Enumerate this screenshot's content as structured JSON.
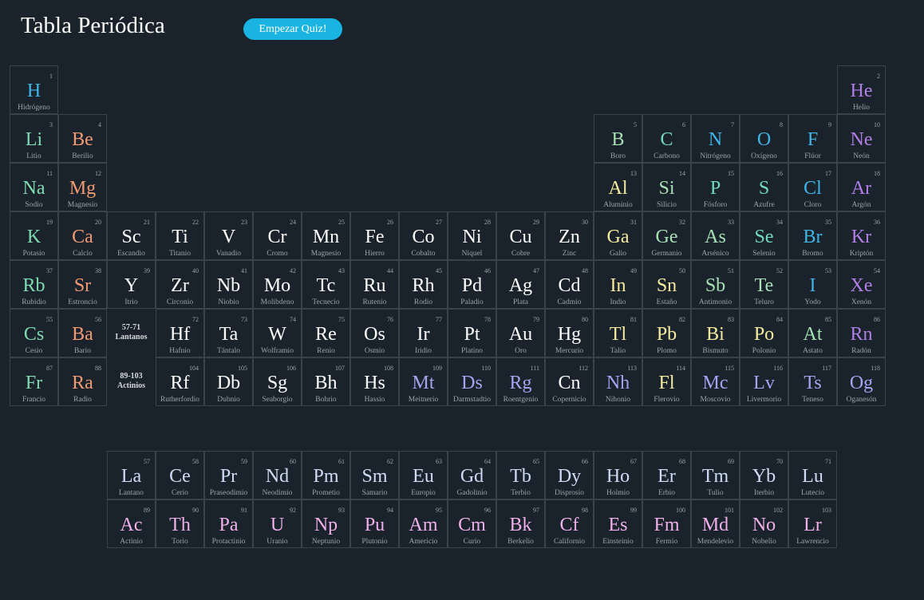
{
  "app": {
    "title": "Tabla Periódica",
    "quiz_button": "Empezar Quiz!"
  },
  "colors": {
    "background": "#1a232b",
    "cell_border": "#38434c",
    "button": "#1ab4e2",
    "categories": {
      "hidrogeno": "#3fb6e6",
      "alcalino": "#7fdbb1",
      "alcalinoterreo": "#f39a72",
      "transicion": "#ffffff",
      "postransicion": "#f6eca0",
      "metaloide": "#a8e0b5",
      "nometal": "#72d9c3",
      "halogeno": "#3fb6e6",
      "noble": "#b07fe8",
      "desconocido": "#a7a3f0",
      "lantanido": "#d0dcf6",
      "actinido": "#f0b0ea"
    }
  },
  "placeholders": [
    {
      "id": "lantanos",
      "range": "57-71",
      "label": "Lantanos"
    },
    {
      "id": "actinios",
      "range": "89-103",
      "label": "Actinios"
    }
  ],
  "elements": [
    {
      "n": 1,
      "s": "H",
      "name": "Hidrógeno",
      "c": "hidrogeno"
    },
    {
      "n": 2,
      "s": "He",
      "name": "Helio",
      "c": "noble"
    },
    {
      "n": 3,
      "s": "Li",
      "name": "Litio",
      "c": "alcalino"
    },
    {
      "n": 4,
      "s": "Be",
      "name": "Berilio",
      "c": "alcalinoterreo"
    },
    {
      "n": 5,
      "s": "B",
      "name": "Boro",
      "c": "metaloide"
    },
    {
      "n": 6,
      "s": "C",
      "name": "Carbono",
      "c": "nometal"
    },
    {
      "n": 7,
      "s": "N",
      "name": "Nitrógeno",
      "c": "halogeno"
    },
    {
      "n": 8,
      "s": "O",
      "name": "Oxígeno",
      "c": "halogeno"
    },
    {
      "n": 9,
      "s": "F",
      "name": "Flúor",
      "c": "halogeno"
    },
    {
      "n": 10,
      "s": "Ne",
      "name": "Neón",
      "c": "noble"
    },
    {
      "n": 11,
      "s": "Na",
      "name": "Sodio",
      "c": "alcalino"
    },
    {
      "n": 12,
      "s": "Mg",
      "name": "Magnesio",
      "c": "alcalinoterreo"
    },
    {
      "n": 13,
      "s": "Al",
      "name": "Aluminio",
      "c": "postransicion"
    },
    {
      "n": 14,
      "s": "Si",
      "name": "Silicio",
      "c": "metaloide"
    },
    {
      "n": 15,
      "s": "P",
      "name": "Fósforo",
      "c": "nometal"
    },
    {
      "n": 16,
      "s": "S",
      "name": "Azufre",
      "c": "nometal"
    },
    {
      "n": 17,
      "s": "Cl",
      "name": "Cloro",
      "c": "halogeno"
    },
    {
      "n": 18,
      "s": "Ar",
      "name": "Argón",
      "c": "noble"
    },
    {
      "n": 19,
      "s": "K",
      "name": "Potasio",
      "c": "alcalino"
    },
    {
      "n": 20,
      "s": "Ca",
      "name": "Calcio",
      "c": "alcalinoterreo"
    },
    {
      "n": 21,
      "s": "Sc",
      "name": "Escandio",
      "c": "transicion"
    },
    {
      "n": 22,
      "s": "Ti",
      "name": "Titanio",
      "c": "transicion"
    },
    {
      "n": 23,
      "s": "V",
      "name": "Vanadio",
      "c": "transicion"
    },
    {
      "n": 24,
      "s": "Cr",
      "name": "Cromo",
      "c": "transicion"
    },
    {
      "n": 25,
      "s": "Mn",
      "name": "Magnesio",
      "c": "transicion"
    },
    {
      "n": 26,
      "s": "Fe",
      "name": "Hierro",
      "c": "transicion"
    },
    {
      "n": 27,
      "s": "Co",
      "name": "Cobalto",
      "c": "transicion"
    },
    {
      "n": 28,
      "s": "Ni",
      "name": "Níquel",
      "c": "transicion"
    },
    {
      "n": 29,
      "s": "Cu",
      "name": "Cobre",
      "c": "transicion"
    },
    {
      "n": 30,
      "s": "Zn",
      "name": "Zinc",
      "c": "transicion"
    },
    {
      "n": 31,
      "s": "Ga",
      "name": "Galio",
      "c": "postransicion"
    },
    {
      "n": 32,
      "s": "Ge",
      "name": "Germanio",
      "c": "metaloide"
    },
    {
      "n": 33,
      "s": "As",
      "name": "Arsénico",
      "c": "metaloide"
    },
    {
      "n": 34,
      "s": "Se",
      "name": "Selenio",
      "c": "nometal"
    },
    {
      "n": 35,
      "s": "Br",
      "name": "Bromo",
      "c": "halogeno"
    },
    {
      "n": 36,
      "s": "Kr",
      "name": "Kriptón",
      "c": "noble"
    },
    {
      "n": 37,
      "s": "Rb",
      "name": "Rubidio",
      "c": "alcalino"
    },
    {
      "n": 38,
      "s": "Sr",
      "name": "Estroncio",
      "c": "alcalinoterreo"
    },
    {
      "n": 39,
      "s": "Y",
      "name": "Itrio",
      "c": "transicion"
    },
    {
      "n": 40,
      "s": "Zr",
      "name": "Circonio",
      "c": "transicion"
    },
    {
      "n": 41,
      "s": "Nb",
      "name": "Niobio",
      "c": "transicion"
    },
    {
      "n": 42,
      "s": "Mo",
      "name": "Molibdeno",
      "c": "transicion"
    },
    {
      "n": 43,
      "s": "Tc",
      "name": "Tecnecio",
      "c": "transicion"
    },
    {
      "n": 44,
      "s": "Ru",
      "name": "Rutenio",
      "c": "transicion"
    },
    {
      "n": 45,
      "s": "Rh",
      "name": "Rodio",
      "c": "transicion"
    },
    {
      "n": 46,
      "s": "Pd",
      "name": "Paladio",
      "c": "transicion"
    },
    {
      "n": 47,
      "s": "Ag",
      "name": "Plata",
      "c": "transicion"
    },
    {
      "n": 48,
      "s": "Cd",
      "name": "Cadmio",
      "c": "transicion"
    },
    {
      "n": 49,
      "s": "In",
      "name": "Indio",
      "c": "postransicion"
    },
    {
      "n": 50,
      "s": "Sn",
      "name": "Estaño",
      "c": "postransicion"
    },
    {
      "n": 51,
      "s": "Sb",
      "name": "Antimonio",
      "c": "metaloide"
    },
    {
      "n": 52,
      "s": "Te",
      "name": "Teluro",
      "c": "metaloide"
    },
    {
      "n": 53,
      "s": "I",
      "name": "Yodo",
      "c": "halogeno"
    },
    {
      "n": 54,
      "s": "Xe",
      "name": "Xenón",
      "c": "noble"
    },
    {
      "n": 55,
      "s": "Cs",
      "name": "Cesio",
      "c": "alcalino"
    },
    {
      "n": 56,
      "s": "Ba",
      "name": "Bario",
      "c": "alcalinoterreo"
    },
    {
      "n": 72,
      "s": "Hf",
      "name": "Hafnio",
      "c": "transicion"
    },
    {
      "n": 73,
      "s": "Ta",
      "name": "Tántalo",
      "c": "transicion"
    },
    {
      "n": 74,
      "s": "W",
      "name": "Wolframio",
      "c": "transicion"
    },
    {
      "n": 75,
      "s": "Re",
      "name": "Renio",
      "c": "transicion"
    },
    {
      "n": 76,
      "s": "Os",
      "name": "Osmio",
      "c": "transicion"
    },
    {
      "n": 77,
      "s": "Ir",
      "name": "Iridio",
      "c": "transicion"
    },
    {
      "n": 78,
      "s": "Pt",
      "name": "Platino",
      "c": "transicion"
    },
    {
      "n": 79,
      "s": "Au",
      "name": "Oro",
      "c": "transicion"
    },
    {
      "n": 80,
      "s": "Hg",
      "name": "Mercurio",
      "c": "transicion"
    },
    {
      "n": 81,
      "s": "Tl",
      "name": "Talio",
      "c": "postransicion"
    },
    {
      "n": 82,
      "s": "Pb",
      "name": "Plomo",
      "c": "postransicion"
    },
    {
      "n": 83,
      "s": "Bi",
      "name": "Bismuto",
      "c": "postransicion"
    },
    {
      "n": 84,
      "s": "Po",
      "name": "Polonio",
      "c": "postransicion"
    },
    {
      "n": 85,
      "s": "At",
      "name": "Astato",
      "c": "metaloide"
    },
    {
      "n": 86,
      "s": "Rn",
      "name": "Radón",
      "c": "noble"
    },
    {
      "n": 87,
      "s": "Fr",
      "name": "Francio",
      "c": "alcalino"
    },
    {
      "n": 88,
      "s": "Ra",
      "name": "Radio",
      "c": "alcalinoterreo"
    },
    {
      "n": 104,
      "s": "Rf",
      "name": "Rutherfordio",
      "c": "transicion"
    },
    {
      "n": 105,
      "s": "Db",
      "name": "Dubnio",
      "c": "transicion"
    },
    {
      "n": 106,
      "s": "Sg",
      "name": "Seaborgio",
      "c": "transicion"
    },
    {
      "n": 107,
      "s": "Bh",
      "name": "Bohrio",
      "c": "transicion"
    },
    {
      "n": 108,
      "s": "Hs",
      "name": "Hassio",
      "c": "transicion"
    },
    {
      "n": 109,
      "s": "Mt",
      "name": "Meitnerio",
      "c": "desconocido"
    },
    {
      "n": 110,
      "s": "Ds",
      "name": "Darmstadtio",
      "c": "desconocido"
    },
    {
      "n": 111,
      "s": "Rg",
      "name": "Roentgenio",
      "c": "desconocido"
    },
    {
      "n": 112,
      "s": "Cn",
      "name": "Copernicio",
      "c": "transicion"
    },
    {
      "n": 113,
      "s": "Nh",
      "name": "Nihonio",
      "c": "desconocido"
    },
    {
      "n": 114,
      "s": "Fl",
      "name": "Flerovio",
      "c": "postransicion"
    },
    {
      "n": 115,
      "s": "Mc",
      "name": "Moscovio",
      "c": "desconocido"
    },
    {
      "n": 116,
      "s": "Lv",
      "name": "Livermorio",
      "c": "desconocido"
    },
    {
      "n": 117,
      "s": "Ts",
      "name": "Teneso",
      "c": "desconocido"
    },
    {
      "n": 118,
      "s": "Og",
      "name": "Oganesón",
      "c": "desconocido"
    },
    {
      "n": 57,
      "s": "La",
      "name": "Lantano",
      "c": "lantanido"
    },
    {
      "n": 58,
      "s": "Ce",
      "name": "Cerio",
      "c": "lantanido"
    },
    {
      "n": 59,
      "s": "Pr",
      "name": "Praseodimio",
      "c": "lantanido"
    },
    {
      "n": 60,
      "s": "Nd",
      "name": "Neodimio",
      "c": "lantanido"
    },
    {
      "n": 61,
      "s": "Pm",
      "name": "Prometio",
      "c": "lantanido"
    },
    {
      "n": 62,
      "s": "Sm",
      "name": "Samario",
      "c": "lantanido"
    },
    {
      "n": 63,
      "s": "Eu",
      "name": "Europio",
      "c": "lantanido"
    },
    {
      "n": 64,
      "s": "Gd",
      "name": "Gadolinio",
      "c": "lantanido"
    },
    {
      "n": 65,
      "s": "Tb",
      "name": "Terbio",
      "c": "lantanido"
    },
    {
      "n": 66,
      "s": "Dy",
      "name": "Disprosio",
      "c": "lantanido"
    },
    {
      "n": 67,
      "s": "Ho",
      "name": "Holmio",
      "c": "lantanido"
    },
    {
      "n": 68,
      "s": "Er",
      "name": "Erbio",
      "c": "lantanido"
    },
    {
      "n": 69,
      "s": "Tm",
      "name": "Tulio",
      "c": "lantanido"
    },
    {
      "n": 70,
      "s": "Yb",
      "name": "Iterbio",
      "c": "lantanido"
    },
    {
      "n": 71,
      "s": "Lu",
      "name": "Lutecio",
      "c": "lantanido"
    },
    {
      "n": 89,
      "s": "Ac",
      "name": "Actinio",
      "c": "actinido"
    },
    {
      "n": 90,
      "s": "Th",
      "name": "Torio",
      "c": "actinido"
    },
    {
      "n": 91,
      "s": "Pa",
      "name": "Protactinio",
      "c": "actinido"
    },
    {
      "n": 92,
      "s": "U",
      "name": "Uranio",
      "c": "actinido"
    },
    {
      "n": 93,
      "s": "Np",
      "name": "Neptunio",
      "c": "actinido"
    },
    {
      "n": 94,
      "s": "Pu",
      "name": "Plutonio",
      "c": "actinido"
    },
    {
      "n": 95,
      "s": "Am",
      "name": "Americio",
      "c": "actinido"
    },
    {
      "n": 96,
      "s": "Cm",
      "name": "Curio",
      "c": "actinido"
    },
    {
      "n": 97,
      "s": "Bk",
      "name": "Berkelio",
      "c": "actinido"
    },
    {
      "n": 98,
      "s": "Cf",
      "name": "Californio",
      "c": "actinido"
    },
    {
      "n": 99,
      "s": "Es",
      "name": "Einsteinio",
      "c": "actinido"
    },
    {
      "n": 100,
      "s": "Fm",
      "name": "Fermio",
      "c": "actinido"
    },
    {
      "n": 101,
      "s": "Md",
      "name": "Mendelevio",
      "c": "actinido"
    },
    {
      "n": 102,
      "s": "No",
      "name": "Nobelio",
      "c": "actinido"
    },
    {
      "n": 103,
      "s": "Lr",
      "name": "Lawrencio",
      "c": "actinido"
    }
  ]
}
